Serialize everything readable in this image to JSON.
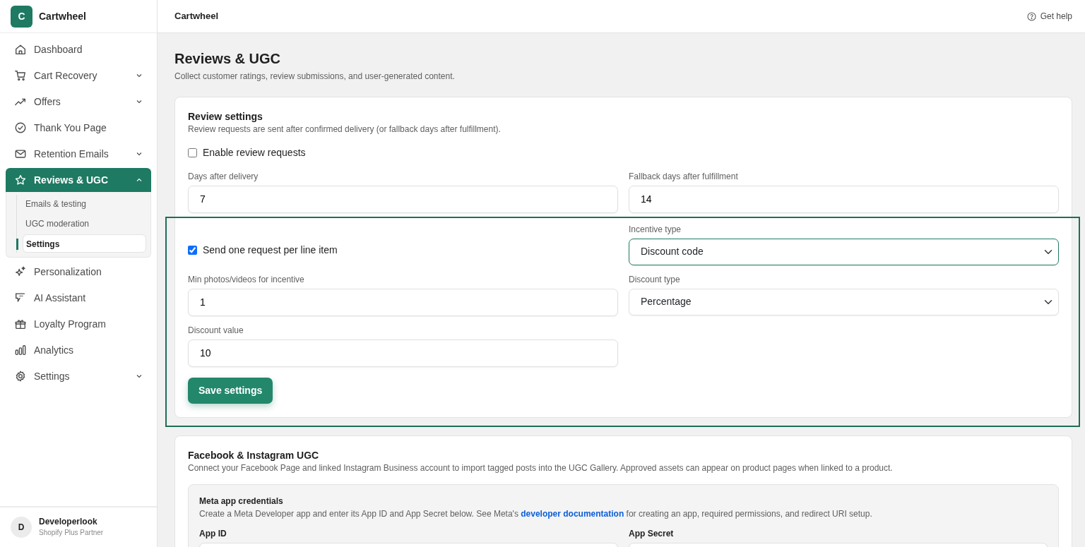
{
  "sidebar": {
    "brand": {
      "initial": "C",
      "name": "Cartwheel"
    },
    "items": [
      {
        "label": "Dashboard",
        "expandable": false,
        "selected": false
      },
      {
        "label": "Cart Recovery",
        "expandable": true,
        "expanded": false,
        "selected": false
      },
      {
        "label": "Offers",
        "expandable": true,
        "expanded": false,
        "selected": false
      },
      {
        "label": "Thank You Page",
        "expandable": false,
        "selected": false
      },
      {
        "label": "Retention Emails",
        "expandable": true,
        "expanded": false,
        "selected": false
      },
      {
        "label": "Reviews & UGC",
        "expandable": true,
        "expanded": true,
        "selected": true,
        "children": [
          {
            "label": "Emails & testing",
            "selected": false
          },
          {
            "label": "UGC moderation",
            "selected": false
          },
          {
            "label": "Settings",
            "selected": true
          }
        ]
      },
      {
        "label": "Personalization",
        "expandable": false,
        "selected": false
      },
      {
        "label": "AI Assistant",
        "expandable": false,
        "selected": false
      },
      {
        "label": "Loyalty Program",
        "expandable": false,
        "selected": false
      },
      {
        "label": "Analytics",
        "expandable": false,
        "selected": false
      },
      {
        "label": "Settings",
        "expandable": true,
        "expanded": false,
        "selected": false
      }
    ],
    "user": {
      "initial": "D",
      "name": "Developerlook",
      "subtitle": "Shopify Plus Partner"
    }
  },
  "header": {
    "title": "Cartwheel",
    "help": "Get help"
  },
  "page": {
    "title": "Reviews & UGC",
    "subtitle": "Collect customer ratings, review submissions, and user-generated content."
  },
  "review_settings": {
    "title": "Review settings",
    "description": "Review requests are sent after confirmed delivery (or fallback days after fulfillment).",
    "enable": {
      "label": "Enable review requests",
      "checked": false
    },
    "fields": [
      {
        "label": "Days after delivery",
        "value": "7"
      },
      {
        "label": "Fallback days after fulfillment",
        "value": "14"
      }
    ],
    "incentive": {
      "highlighted": true,
      "per_line": {
        "label": "Send one request per line item",
        "checked": true
      },
      "incentive_type": {
        "label": "Incentive type",
        "value": "Discount code",
        "focused": true
      },
      "min_photos": {
        "label": "Min photos/videos for incentive",
        "value": "1"
      },
      "discount_type": {
        "label": "Discount type",
        "value": "Percentage",
        "focused": false
      },
      "discount_value": {
        "label": "Discount value",
        "value": "10"
      },
      "save_button": "Save settings"
    }
  },
  "ugc": {
    "title": "Facebook & Instagram UGC",
    "description": "Connect your Facebook Page and linked Instagram Business account to import tagged posts into the UGC Gallery. Approved assets can appear on product pages when linked to a product.",
    "credentials": {
      "title": "Meta app credentials",
      "text_before": "Create a Meta Developer app and enter its App ID and App Secret below. See Meta's",
      "link": "developer documentation",
      "text_after": "for creating an app, required permissions, and redirect URI setup.",
      "fields": [
        {
          "label": "App ID"
        },
        {
          "label": "App Secret"
        }
      ]
    }
  }
}
